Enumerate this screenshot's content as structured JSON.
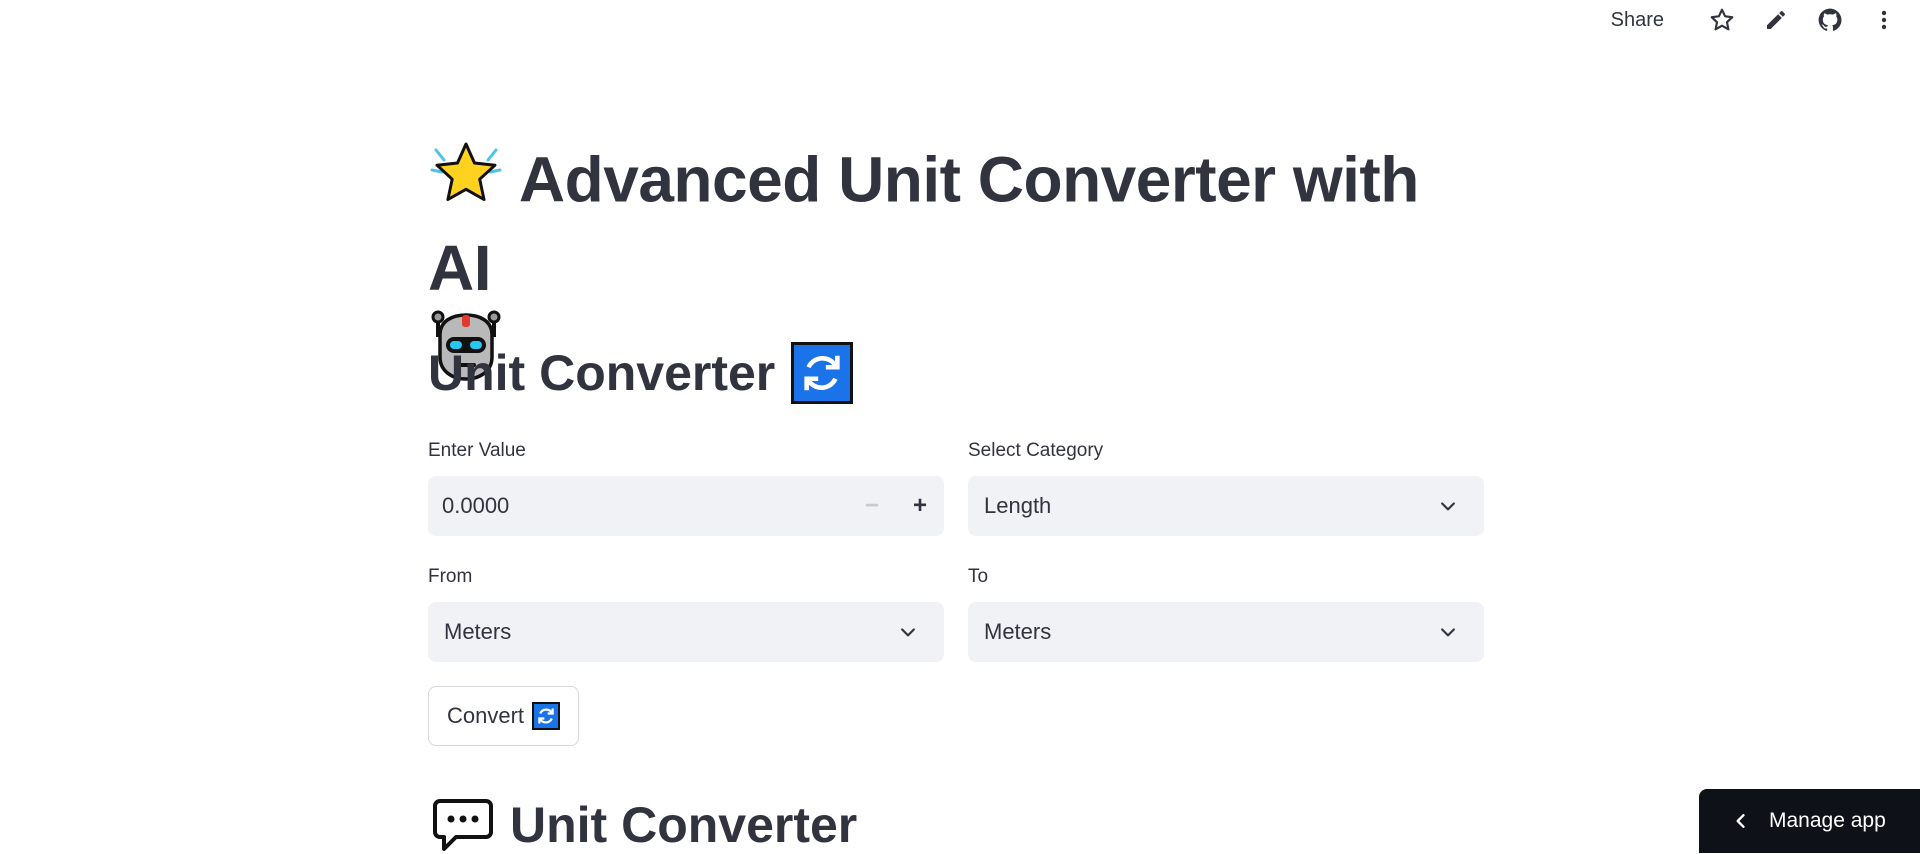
{
  "toolbar": {
    "share_label": "Share",
    "icons": [
      "star-icon",
      "pencil-icon",
      "github-icon",
      "more-vertical-icon"
    ]
  },
  "title": {
    "text": "Advanced Unit Converter with AI",
    "leading_icon": "sparkle-star-icon",
    "trailing_icon": "robot-icon"
  },
  "converter": {
    "heading": "Unit Converter",
    "heading_icon": "refresh-icon",
    "value": {
      "label": "Enter Value",
      "current": "0.0000",
      "minus_label": "−",
      "plus_label": "+"
    },
    "category": {
      "label": "Select Category",
      "selected": "Length"
    },
    "from": {
      "label": "From",
      "selected": "Meters"
    },
    "to": {
      "label": "To",
      "selected": "Meters"
    },
    "convert_label": "Convert"
  },
  "chat_section": {
    "heading": "Unit Converter",
    "icon": "speech-bubble-icon"
  },
  "manage_app": {
    "label": "Manage app"
  },
  "colors": {
    "text": "#31333f",
    "input_bg": "#f0f2f6",
    "manage_bg": "#0e1117",
    "refresh_blue": "#1a73e8"
  }
}
